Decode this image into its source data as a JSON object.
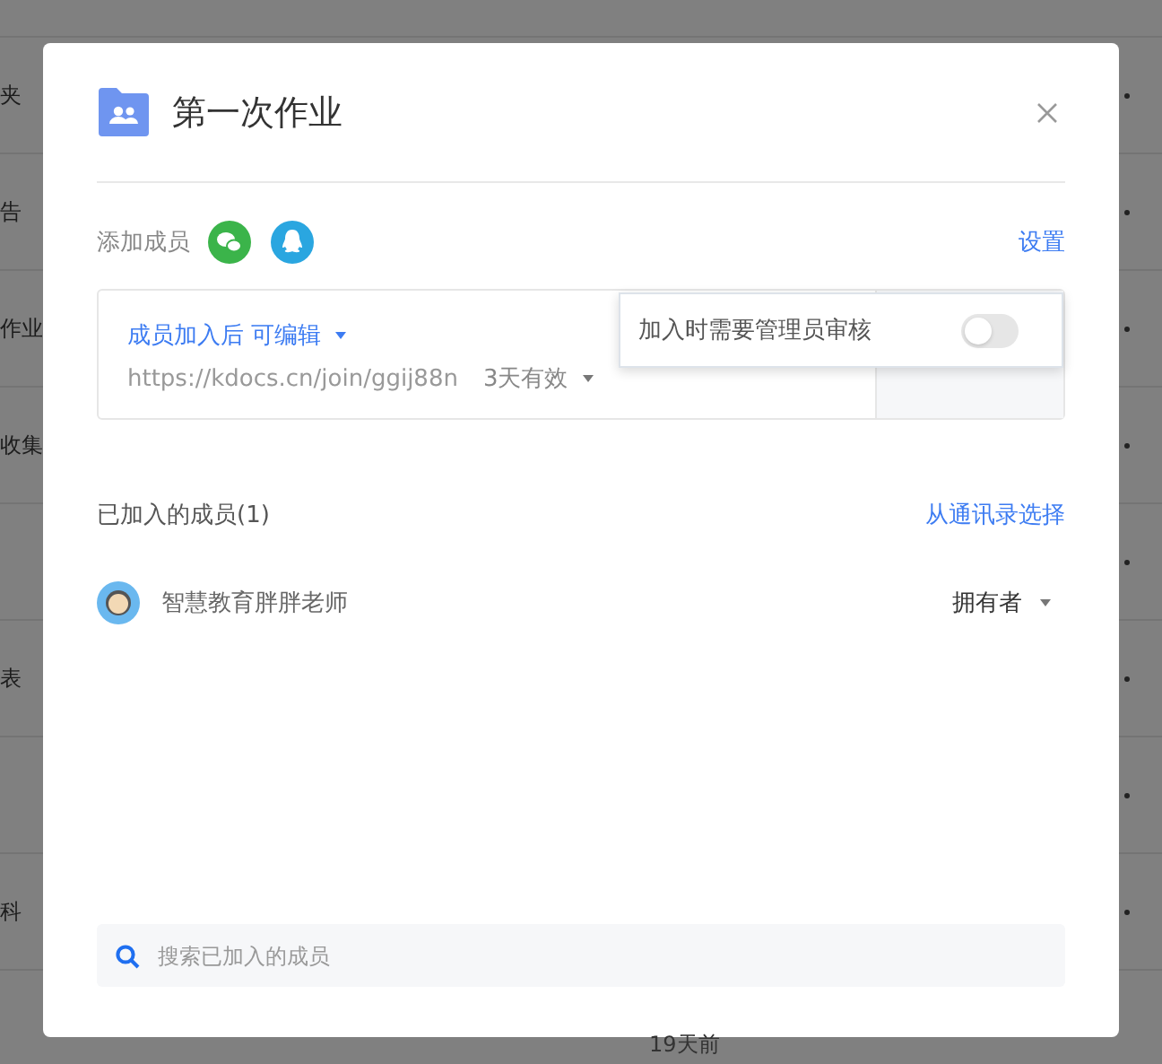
{
  "background": {
    "rows": [
      {
        "label": "夹"
      },
      {
        "label": "告"
      },
      {
        "label": "作业"
      },
      {
        "label": "收集"
      },
      {
        "label": ""
      },
      {
        "label": "表"
      },
      {
        "label": ""
      },
      {
        "label": "科"
      }
    ],
    "footer_time": "19天前"
  },
  "dialog": {
    "title": "第一次作业",
    "add_members": {
      "label": "添加成员",
      "settings_link": "设置"
    },
    "invite": {
      "permission": "成员加入后 可编辑",
      "url": "https://kdocs.cn/join/ggij88n",
      "validity": "3天有效"
    },
    "approval_popover": {
      "label": "加入时需要管理员审核",
      "on": false
    },
    "members_heading": "已加入的成员(1)",
    "contacts_link": "从通讯录选择",
    "members": [
      {
        "name": "智慧教育胖胖老师",
        "role": "拥有者"
      }
    ],
    "search": {
      "placeholder": "搜索已加入的成员"
    }
  }
}
